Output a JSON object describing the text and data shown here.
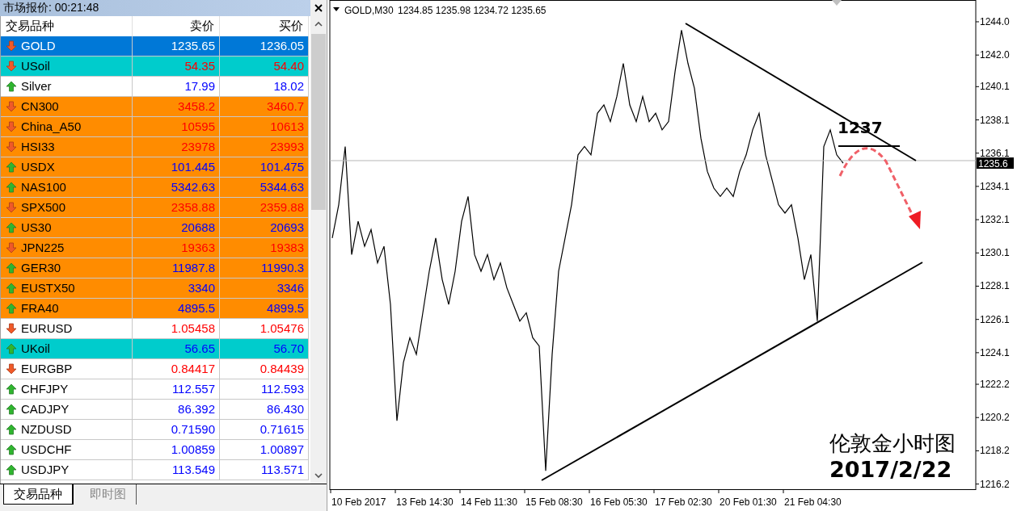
{
  "market_watch": {
    "title": "市场报价: 00:21:48",
    "columns": [
      "交易品种",
      "卖价",
      "买价"
    ],
    "rows": [
      {
        "symbol": "GOLD",
        "bid": "1235.65",
        "ask": "1236.05",
        "kind": "down",
        "selected": true
      },
      {
        "symbol": "USoil",
        "bid": "54.35",
        "ask": "54.40",
        "kind": "down",
        "selected": false,
        "color": "#00cccc"
      },
      {
        "symbol": "Silver",
        "bid": "17.99",
        "ask": "18.02",
        "kind": "up",
        "selected": false,
        "color": "#ffffff"
      },
      {
        "symbol": "CN300",
        "bid": "3458.2",
        "ask": "3460.7",
        "kind": "down",
        "selected": false,
        "color": "#ff8c00"
      },
      {
        "symbol": "China_A50",
        "bid": "10595",
        "ask": "10613",
        "kind": "down",
        "selected": false,
        "color": "#ff8c00"
      },
      {
        "symbol": "HSI33",
        "bid": "23978",
        "ask": "23993",
        "kind": "down",
        "selected": false,
        "color": "#ff8c00"
      },
      {
        "symbol": "USDX",
        "bid": "101.445",
        "ask": "101.475",
        "kind": "up",
        "selected": false,
        "color": "#ff8c00"
      },
      {
        "symbol": "NAS100",
        "bid": "5342.63",
        "ask": "5344.63",
        "kind": "up",
        "selected": false,
        "color": "#ff8c00"
      },
      {
        "symbol": "SPX500",
        "bid": "2358.88",
        "ask": "2359.88",
        "kind": "down",
        "selected": false,
        "color": "#ff8c00"
      },
      {
        "symbol": "US30",
        "bid": "20688",
        "ask": "20693",
        "kind": "up",
        "selected": false,
        "color": "#ff8c00"
      },
      {
        "symbol": "JPN225",
        "bid": "19363",
        "ask": "19383",
        "kind": "down",
        "selected": false,
        "color": "#ff8c00"
      },
      {
        "symbol": "GER30",
        "bid": "11987.8",
        "ask": "11990.3",
        "kind": "up",
        "selected": false,
        "color": "#ff8c00"
      },
      {
        "symbol": "EUSTX50",
        "bid": "3340",
        "ask": "3346",
        "kind": "up",
        "selected": false,
        "color": "#ff8c00"
      },
      {
        "symbol": "FRA40",
        "bid": "4895.5",
        "ask": "4899.5",
        "kind": "up",
        "selected": false,
        "color": "#ff8c00"
      },
      {
        "symbol": "EURUSD",
        "bid": "1.05458",
        "ask": "1.05476",
        "kind": "down",
        "selected": false,
        "color": "#ffffff"
      },
      {
        "symbol": "UKoil",
        "bid": "56.65",
        "ask": "56.70",
        "kind": "up",
        "selected": false,
        "color": "#00cccc"
      },
      {
        "symbol": "EURGBP",
        "bid": "0.84417",
        "ask": "0.84439",
        "kind": "down",
        "selected": false,
        "color": "#ffffff"
      },
      {
        "symbol": "CHFJPY",
        "bid": "112.557",
        "ask": "112.593",
        "kind": "up",
        "selected": false,
        "color": "#ffffff"
      },
      {
        "symbol": "CADJPY",
        "bid": "86.392",
        "ask": "86.430",
        "kind": "up",
        "selected": false,
        "color": "#ffffff"
      },
      {
        "symbol": "NZDUSD",
        "bid": "0.71590",
        "ask": "0.71615",
        "kind": "up",
        "selected": false,
        "color": "#ffffff"
      },
      {
        "symbol": "USDCHF",
        "bid": "1.00859",
        "ask": "1.00897",
        "kind": "up",
        "selected": false,
        "color": "#ffffff"
      },
      {
        "symbol": "USDJPY",
        "bid": "113.549",
        "ask": "113.571",
        "kind": "up",
        "selected": false,
        "color": "#ffffff"
      }
    ],
    "tabs": [
      {
        "label": "交易品种",
        "selected": true
      },
      {
        "label": "即时图",
        "selected": false
      }
    ]
  },
  "chart": {
    "symbol": "GOLD,M30",
    "ohlc": "1234.85 1235.98 1234.72 1235.65",
    "current_price_label": "1235.6",
    "overlay_title": "伦敦金小时图",
    "overlay_date": "2017/2/22",
    "level_label": "1237",
    "time_labels": [
      "10 Feb 2017",
      "13 Feb 14:30",
      "14 Feb 11:30",
      "15 Feb 08:30",
      "16 Feb 05:30",
      "17 Feb 02:30",
      "20 Feb 01:30",
      "21 Feb 04:30"
    ],
    "chart_data": {
      "type": "line",
      "ylim": [
        1215.89,
        1245.31
      ],
      "ref_lines": [
        {
          "axis": "y",
          "value": 1235.65,
          "color": "#b8b8b8"
        }
      ],
      "series": [
        {
          "color": "#000000",
          "values": [
            1231,
            1233,
            1236.5,
            1230,
            1232,
            1230.5,
            1231.5,
            1229.5,
            1230.5,
            1227,
            1220,
            1223.5,
            1225,
            1224,
            1226.5,
            1229,
            1231,
            1228.5,
            1227,
            1229,
            1232,
            1233.5,
            1230,
            1229,
            1230,
            1228.5,
            1229.5,
            1228,
            1227,
            1226,
            1226.5,
            1225,
            1224.5,
            1217,
            1224,
            1229,
            1231,
            1233,
            1236,
            1236.5,
            1236,
            1238.5,
            1239,
            1238,
            1239.5,
            1241.5,
            1239,
            1238,
            1239.5,
            1238,
            1238.5,
            1237.5,
            1238,
            1241,
            1243.5,
            1241.5,
            1240,
            1237,
            1235,
            1234,
            1233.5,
            1234,
            1233.5,
            1235,
            1236,
            1237.5,
            1238.5,
            1236,
            1234.5,
            1233,
            1232.5,
            1233,
            1231,
            1228.5,
            1230,
            1226,
            1236.5,
            1237.5,
            1236,
            1235.5
          ]
        }
      ],
      "yticks": [
        {
          "value": 1244.0,
          "label": "1244.0"
        },
        {
          "value": 1242.0,
          "label": "1242.0"
        },
        {
          "value": 1240.1,
          "label": "1240.1"
        },
        {
          "value": 1238.1,
          "label": "1238.1"
        },
        {
          "value": 1236.1,
          "label": "1236.1"
        },
        {
          "value": 1234.1,
          "label": "1234.1"
        },
        {
          "value": 1232.1,
          "label": "1232.1"
        },
        {
          "value": 1230.1,
          "label": "1230.1"
        },
        {
          "value": 1228.1,
          "label": "1228.1"
        },
        {
          "value": 1226.1,
          "label": "1226.1"
        },
        {
          "value": 1224.1,
          "label": "1224.1"
        },
        {
          "value": 1222.2,
          "label": "1222.2"
        },
        {
          "value": 1220.2,
          "label": "1220.2"
        },
        {
          "value": 1218.2,
          "label": "1218.2"
        },
        {
          "value": 1216.2,
          "label": "1216.2"
        }
      ]
    }
  }
}
